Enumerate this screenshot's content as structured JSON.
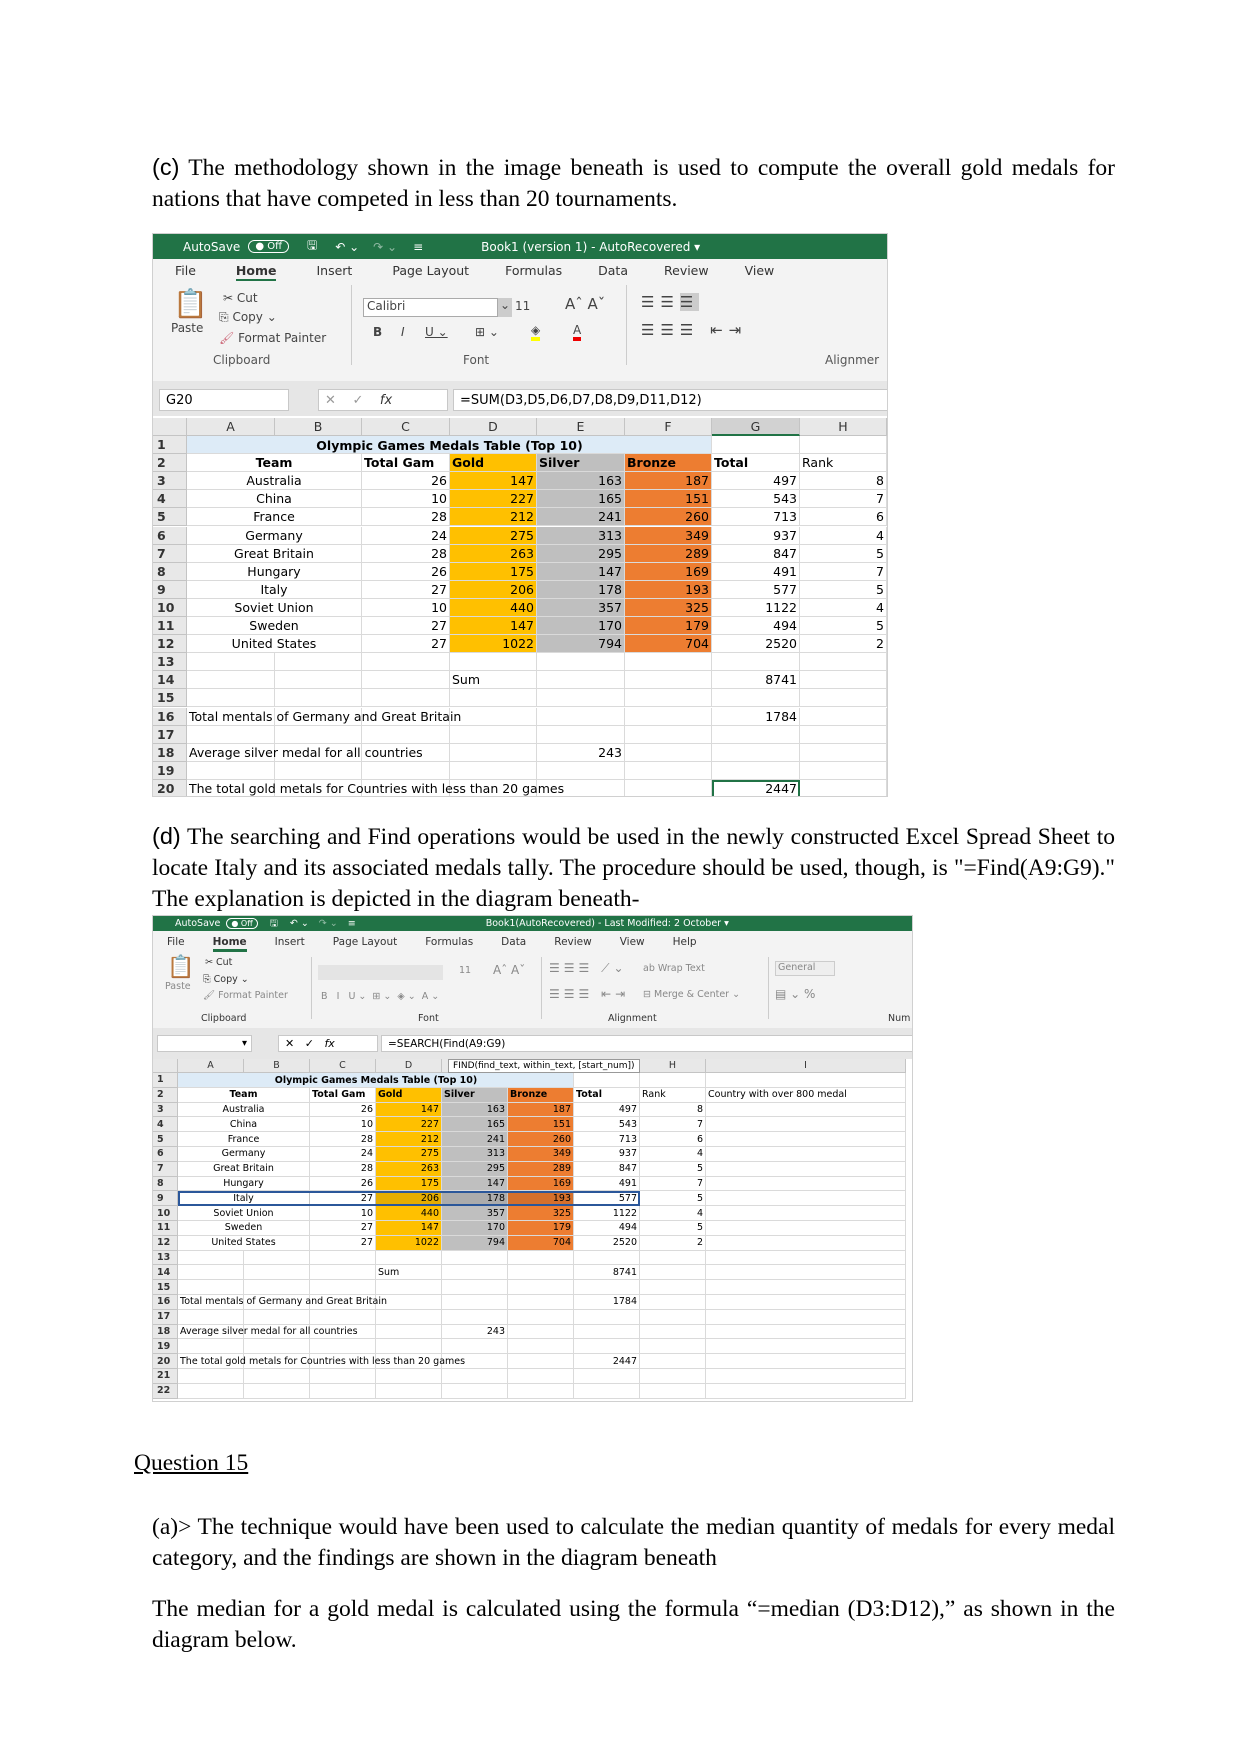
{
  "doc": {
    "para_c_label": "(c)",
    "para_c": " The methodology shown in the image beneath is used to compute the overall gold medals for nations that have competed in less than 20 tournaments.",
    "para_d_label": "(d)",
    "para_d": " The searching and Find operations would be used in the newly constructed Excel Spread Sheet to locate Italy and its associated medals tally. The procedure should be used, though, is \"=Find(A9:G9).\" The explanation is depicted in the diagram beneath-",
    "question": "Question 15",
    "para_a": "(a)> The technique would have been used to calculate the median quantity of medals for every medal category, and the findings are shown in the diagram beneath",
    "para_median": "The median for a gold medal is calculated using the formula “=median (D3:D12),” as shown in the diagram below."
  },
  "colors": {
    "excel_green": "#217346",
    "gold": "#ffc000",
    "silver": "#bfbfbf",
    "bronze": "#ed7d31",
    "title_fill": "#ddebf7"
  },
  "sheet1": {
    "autosave": "AutoSave",
    "toggle": "Off",
    "title": "Book1 (version 1)  -  AutoRecovered  ▾",
    "tabs": [
      "File",
      "Home",
      "Insert",
      "Page Layout",
      "Formulas",
      "Data",
      "Review",
      "View"
    ],
    "ribbon": {
      "paste": "Paste",
      "cut": "Cut",
      "copy": "Copy",
      "format_painter": "Format Painter",
      "font_name": "Calibri",
      "font_size": "11",
      "clipboard": "Clipboard",
      "font": "Font",
      "alignment": "Alignmer"
    },
    "name_box": "G20",
    "formula": "=SUM(D3,D5,D6,D7,D8,D9,D11,D12)",
    "columns": [
      "A",
      "B",
      "C",
      "D",
      "E",
      "F",
      "G",
      "H"
    ],
    "table_title": "Olympic Games Medals Table (Top 10)",
    "rows": [
      [
        "",
        "",
        "",
        "",
        "",
        "",
        "",
        ""
      ],
      [
        "Team",
        "",
        "Total Gam",
        "Gold",
        "Silver",
        "Bronze",
        "Total",
        "Rank"
      ],
      [
        "Australia",
        "",
        "26",
        "147",
        "163",
        "187",
        "497",
        "8"
      ],
      [
        "China",
        "",
        "10",
        "227",
        "165",
        "151",
        "543",
        "7"
      ],
      [
        "France",
        "",
        "28",
        "212",
        "241",
        "260",
        "713",
        "6"
      ],
      [
        "Germany",
        "",
        "24",
        "275",
        "313",
        "349",
        "937",
        "4"
      ],
      [
        "Great Britain",
        "",
        "28",
        "263",
        "295",
        "289",
        "847",
        "5"
      ],
      [
        "Hungary",
        "",
        "26",
        "175",
        "147",
        "169",
        "491",
        "7"
      ],
      [
        "Italy",
        "",
        "27",
        "206",
        "178",
        "193",
        "577",
        "5"
      ],
      [
        "Soviet Union",
        "",
        "10",
        "440",
        "357",
        "325",
        "1122",
        "4"
      ],
      [
        "Sweden",
        "",
        "27",
        "147",
        "170",
        "179",
        "494",
        "5"
      ],
      [
        "United States",
        "",
        "27",
        "1022",
        "794",
        "704",
        "2520",
        "2"
      ],
      [
        "",
        "",
        "",
        "",
        "",
        "",
        "",
        ""
      ],
      [
        "",
        "",
        "",
        "Sum",
        "",
        "",
        "8741",
        ""
      ],
      [
        "",
        "",
        "",
        "",
        "",
        "",
        "",
        ""
      ],
      [
        "Total mentals of Germany and Great Britain",
        "",
        "",
        "",
        "",
        "",
        "1784",
        ""
      ],
      [
        "",
        "",
        "",
        "",
        "",
        "",
        "",
        ""
      ],
      [
        "Average silver medal for all countries",
        "",
        "",
        "",
        "243",
        "",
        "",
        ""
      ],
      [
        "",
        "",
        "",
        "",
        "",
        "",
        "",
        ""
      ],
      [
        "The total gold metals for Countries with less than 20 games",
        "",
        "",
        "",
        "",
        "",
        "2447",
        ""
      ]
    ]
  },
  "sheet2": {
    "autosave": "AutoSave",
    "toggle": "Off",
    "title": "Book1(AutoRecovered)  -  Last Modified: 2 October  ▾",
    "tabs": [
      "File",
      "Home",
      "Insert",
      "Page Layout",
      "Formulas",
      "Data",
      "Review",
      "View",
      "Help"
    ],
    "ribbon": {
      "paste": "Paste",
      "cut": "Cut",
      "copy": "Copy",
      "format_painter": "Format Painter",
      "font_size": "11",
      "wrap_text": "Wrap Text",
      "merge_center": "Merge & Center",
      "number_format": "General",
      "clipboard": "Clipboard",
      "font": "Font",
      "alignment": "Alignment",
      "number": "Num"
    },
    "name_box": "",
    "formula": "=SEARCH(Find(A9:G9)",
    "tooltip": "FIND(find_text, within_text, [start_num])",
    "columns": [
      "A",
      "B",
      "C",
      "D",
      "E",
      "F",
      "G",
      "H",
      "I"
    ],
    "table_title": "Olympic Games Medals Table (Top 10)",
    "rows": [
      [
        "",
        "",
        "",
        "",
        "",
        "",
        "",
        "",
        ""
      ],
      [
        "Team",
        "",
        "Total Gam",
        "Gold",
        "Silver",
        "Bronze",
        "Total",
        "Rank",
        "Country with over 800 medal"
      ],
      [
        "Australia",
        "",
        "26",
        "147",
        "163",
        "187",
        "497",
        "8",
        ""
      ],
      [
        "China",
        "",
        "10",
        "227",
        "165",
        "151",
        "543",
        "7",
        ""
      ],
      [
        "France",
        "",
        "28",
        "212",
        "241",
        "260",
        "713",
        "6",
        ""
      ],
      [
        "Germany",
        "",
        "24",
        "275",
        "313",
        "349",
        "937",
        "4",
        ""
      ],
      [
        "Great Britain",
        "",
        "28",
        "263",
        "295",
        "289",
        "847",
        "5",
        ""
      ],
      [
        "Hungary",
        "",
        "26",
        "175",
        "147",
        "169",
        "491",
        "7",
        ""
      ],
      [
        "Italy",
        "",
        "27",
        "206",
        "178",
        "193",
        "577",
        "5",
        ""
      ],
      [
        "Soviet Union",
        "",
        "10",
        "440",
        "357",
        "325",
        "1122",
        "4",
        ""
      ],
      [
        "Sweden",
        "",
        "27",
        "147",
        "170",
        "179",
        "494",
        "5",
        ""
      ],
      [
        "United States",
        "",
        "27",
        "1022",
        "794",
        "704",
        "2520",
        "2",
        ""
      ],
      [
        "",
        "",
        "",
        "",
        "",
        "",
        "",
        "",
        ""
      ],
      [
        "",
        "",
        "",
        "Sum",
        "",
        "",
        "8741",
        "",
        ""
      ],
      [
        "",
        "",
        "",
        "",
        "",
        "",
        "",
        "",
        ""
      ],
      [
        "Total mentals of Germany and Great Britain",
        "",
        "",
        "",
        "",
        "",
        "1784",
        "",
        ""
      ],
      [
        "",
        "",
        "",
        "",
        "",
        "",
        "",
        "",
        ""
      ],
      [
        "Average silver medal for all countries",
        "",
        "",
        "",
        "243",
        "",
        "",
        "",
        ""
      ],
      [
        "",
        "",
        "",
        "",
        "",
        "",
        "",
        "",
        ""
      ],
      [
        "The total gold metals for Countries with less than 20 games",
        "",
        "",
        "",
        "",
        "",
        "2447",
        "",
        ""
      ],
      [
        "",
        "",
        "",
        "",
        "",
        "",
        "",
        "",
        ""
      ],
      [
        "",
        "",
        "",
        "",
        "",
        "",
        "",
        "",
        ""
      ]
    ]
  }
}
